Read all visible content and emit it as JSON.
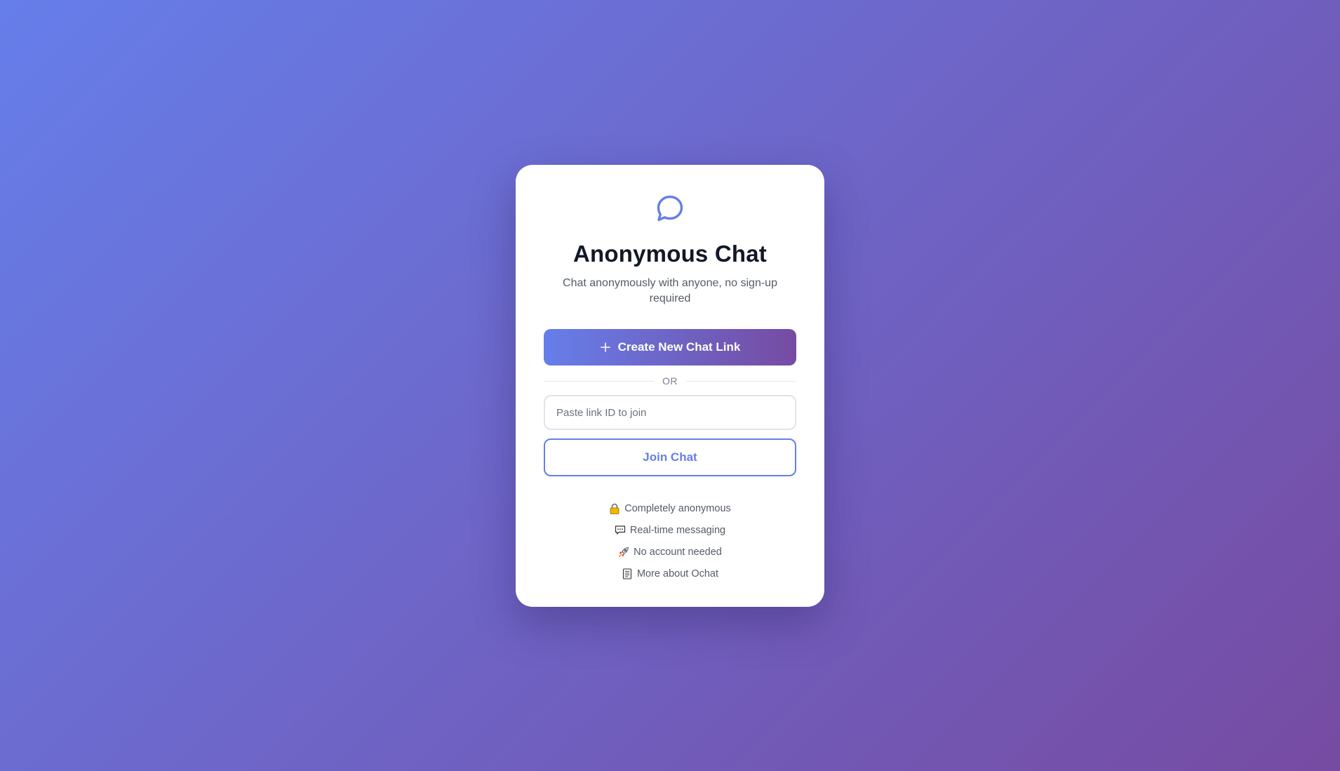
{
  "app": {
    "title": "Anonymous Chat",
    "subtitle": "Chat anonymously with anyone, no sign-up required",
    "logo_icon": "chat-bubble-icon",
    "accent_gradient": [
      "#667eea",
      "#764ba2"
    ]
  },
  "actions": {
    "create_label": "Create New Chat Link",
    "create_icon": "plus-icon",
    "divider_label": "OR",
    "join_placeholder": "Paste link ID to join",
    "join_value": "",
    "join_label": "Join Chat"
  },
  "features": [
    {
      "icon": "lock-icon",
      "label": "Completely anonymous"
    },
    {
      "icon": "speech-balloon-icon",
      "label": "Real-time messaging"
    },
    {
      "icon": "rocket-icon",
      "label": "No account needed"
    },
    {
      "icon": "page-icon",
      "label": "More about Ochat"
    }
  ]
}
